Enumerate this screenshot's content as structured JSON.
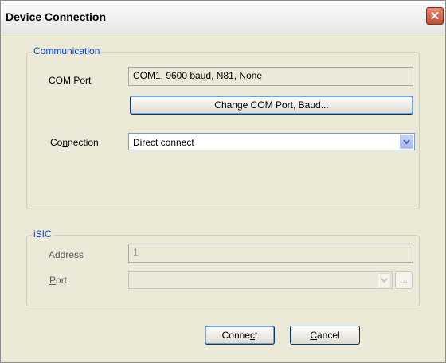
{
  "window": {
    "title": "Device Connection",
    "close_glyph": "✕"
  },
  "communication": {
    "group_label": "Communication",
    "com_port": {
      "label": "COM Port",
      "value": "COM1, 9600 baud, N81, None"
    },
    "change_button": "Change COM Port, Baud...",
    "connection": {
      "label_pre": "Co",
      "label_mnemonic": "n",
      "label_post": "nection",
      "value": "Direct connect"
    }
  },
  "isic": {
    "group_label": "iSIC",
    "address": {
      "label": "Address",
      "value": "1"
    },
    "port": {
      "label_mnemonic": "P",
      "label_post": "ort",
      "value": "",
      "browse_label": "..."
    }
  },
  "buttons": {
    "connect_pre": "Conne",
    "connect_mnemonic": "c",
    "connect_post": "t",
    "cancel_mnemonic": "C",
    "cancel_post": "ancel"
  },
  "icons": {
    "close": "close-icon",
    "dropdown": "chevron-down-icon"
  },
  "colors": {
    "group_label": "#0046d5",
    "close_button": "#c24a2f",
    "dialog_bg": "#ece9d8"
  }
}
